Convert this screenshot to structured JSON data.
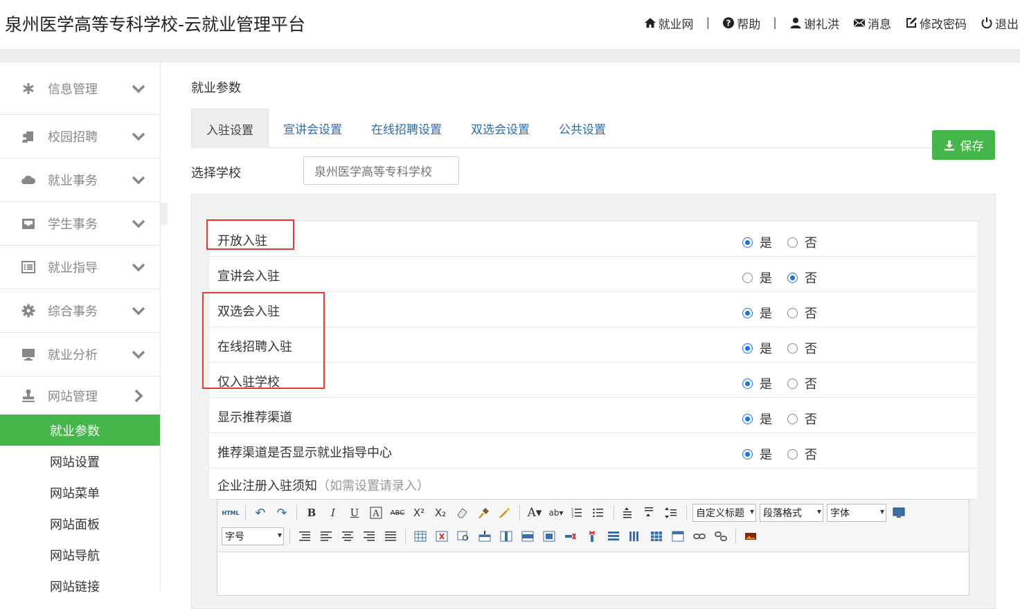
{
  "header": {
    "title": "泉州医学高等专科学校-云就业管理平台",
    "nav": {
      "jobsite": "就业网",
      "sep": "|",
      "help": "帮助",
      "user": "谢礼洪",
      "messages": "消息",
      "change_password": "修改密码",
      "logout": "退出"
    }
  },
  "sidebar": {
    "groups": [
      {
        "label": "信息管理",
        "icon": "asterisk-icon"
      },
      {
        "label": "校园招聘",
        "icon": "user-speaker-icon"
      },
      {
        "label": "就业事务",
        "icon": "cloud-icon"
      },
      {
        "label": "学生事务",
        "icon": "inbox-icon"
      },
      {
        "label": "就业指导",
        "icon": "list-icon"
      },
      {
        "label": "综合事务",
        "icon": "gear-icon"
      },
      {
        "label": "就业分析",
        "icon": "monitor-icon"
      },
      {
        "label": "网站管理",
        "icon": "stamp-icon"
      }
    ],
    "sub_items": [
      "就业参数",
      "网站设置",
      "网站菜单",
      "网站面板",
      "网站导航",
      "网站链接"
    ]
  },
  "main": {
    "heading": "就业参数",
    "tabs": [
      "入驻设置",
      "宣讲会设置",
      "在线招聘设置",
      "双选会设置",
      "公共设置"
    ],
    "save_label": "保存",
    "school_label": "选择学校",
    "school_value": "泉州医学高等专科学校",
    "yes": "是",
    "no": "否",
    "settings": [
      {
        "label": "开放入驻",
        "value": "是"
      },
      {
        "label": "宣讲会入驻",
        "value": "否"
      },
      {
        "label": "双选会入驻",
        "value": "是"
      },
      {
        "label": "在线招聘入驻",
        "value": "是"
      },
      {
        "label": "仅入驻学校",
        "value": "是"
      },
      {
        "label": "显示推荐渠道",
        "value": "是"
      },
      {
        "label": "推荐渠道是否显示就业指导中心",
        "value": "是"
      }
    ],
    "notice_label": "企业注册入驻须知",
    "notice_hint": "（如需设置请录入）",
    "editor": {
      "heading_select": "自定义标题",
      "paragraph_select": "段落格式",
      "font_select": "字体",
      "size_select": "字号"
    }
  },
  "colors": {
    "accent_green": "#45b649",
    "link_blue": "#2a6db0",
    "radio_blue": "#1a73e8",
    "highlight_red": "#e53935"
  }
}
